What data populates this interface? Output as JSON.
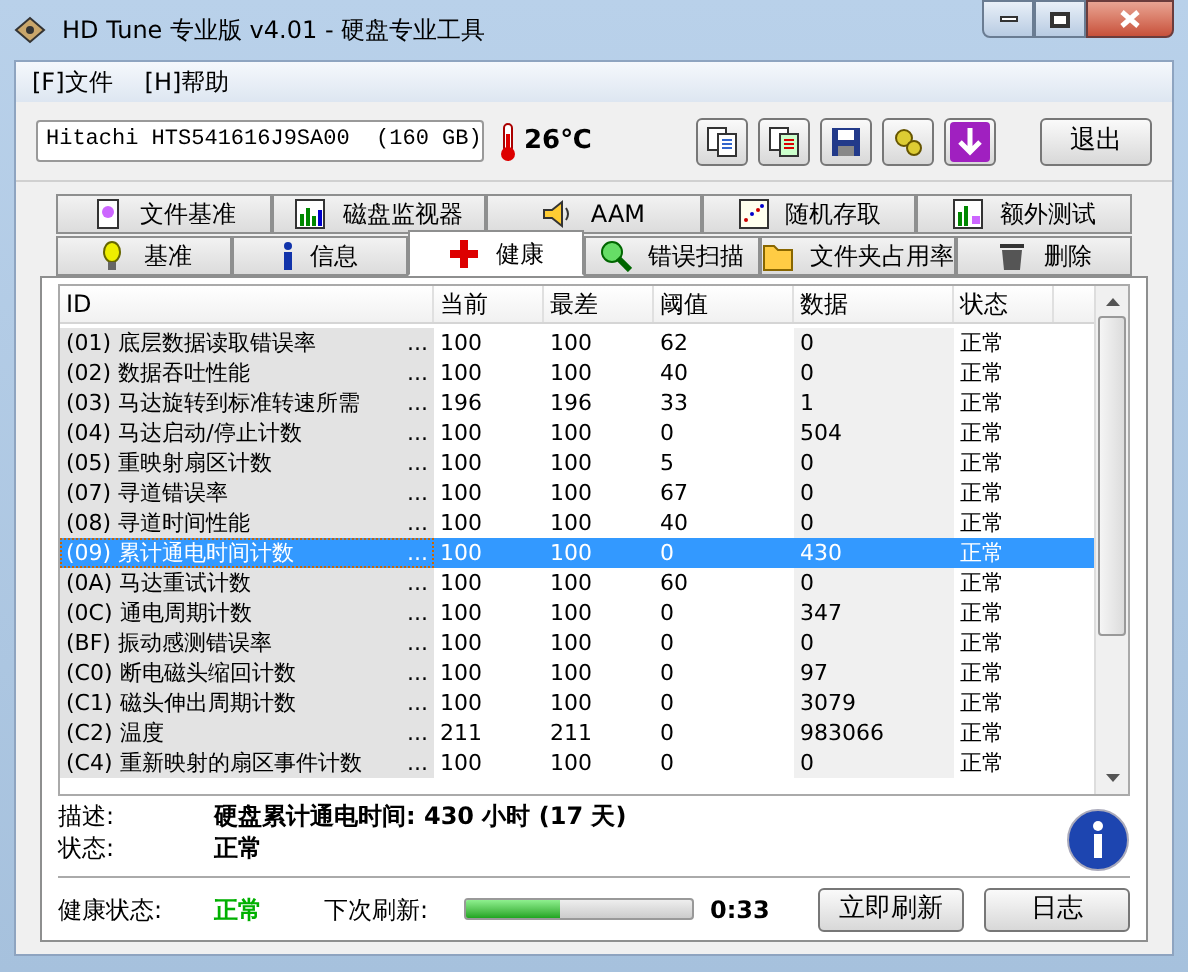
{
  "window": {
    "title": "HD Tune 专业版 v4.01 - 硬盘专业工具"
  },
  "menu": [
    "[F]文件",
    "[H]帮助"
  ],
  "drive": {
    "value": "Hitachi HTS541616J9SA00  (160 GB)"
  },
  "temperature": "26℃",
  "exit_button": "退出",
  "tabs_row_1": [
    {
      "label": "文件基准",
      "selected": false
    },
    {
      "label": "磁盘监视器",
      "selected": false
    },
    {
      "label": "AAM",
      "selected": false
    },
    {
      "label": "随机存取",
      "selected": false
    },
    {
      "label": "额外测试",
      "selected": false
    }
  ],
  "tabs_row_2": [
    {
      "label": "基准",
      "selected": false
    },
    {
      "label": "信息",
      "selected": false
    },
    {
      "label": "健康",
      "selected": true
    },
    {
      "label": "错误扫描",
      "selected": false
    },
    {
      "label": "文件夹占用率",
      "selected": false
    },
    {
      "label": "删除",
      "selected": false
    }
  ],
  "table": {
    "columns": [
      "ID",
      "当前",
      "最差",
      "阈值",
      "数据",
      "状态"
    ],
    "rows": [
      {
        "id": "(01) 底层数据读取错误率",
        "more": "...",
        "current": "100",
        "worst": "100",
        "threshold": "62",
        "data": "0",
        "status": "正常",
        "selected": false
      },
      {
        "id": "(02) 数据吞吐性能",
        "more": "...",
        "current": "100",
        "worst": "100",
        "threshold": "40",
        "data": "0",
        "status": "正常",
        "selected": false
      },
      {
        "id": "(03) 马达旋转到标准转速所需",
        "more": "...",
        "current": "196",
        "worst": "196",
        "threshold": "33",
        "data": "1",
        "status": "正常",
        "selected": false
      },
      {
        "id": "(04) 马达启动/停止计数",
        "more": "...",
        "current": "100",
        "worst": "100",
        "threshold": "0",
        "data": "504",
        "status": "正常",
        "selected": false
      },
      {
        "id": "(05) 重映射扇区计数",
        "more": "...",
        "current": "100",
        "worst": "100",
        "threshold": "5",
        "data": "0",
        "status": "正常",
        "selected": false
      },
      {
        "id": "(07) 寻道错误率",
        "more": "...",
        "current": "100",
        "worst": "100",
        "threshold": "67",
        "data": "0",
        "status": "正常",
        "selected": false
      },
      {
        "id": "(08) 寻道时间性能",
        "more": "...",
        "current": "100",
        "worst": "100",
        "threshold": "40",
        "data": "0",
        "status": "正常",
        "selected": false
      },
      {
        "id": "(09) 累计通电时间计数",
        "more": "...",
        "current": "100",
        "worst": "100",
        "threshold": "0",
        "data": "430",
        "status": "正常",
        "selected": true
      },
      {
        "id": "(0A) 马达重试计数",
        "more": "...",
        "current": "100",
        "worst": "100",
        "threshold": "60",
        "data": "0",
        "status": "正常",
        "selected": false
      },
      {
        "id": "(0C) 通电周期计数",
        "more": "...",
        "current": "100",
        "worst": "100",
        "threshold": "0",
        "data": "347",
        "status": "正常",
        "selected": false
      },
      {
        "id": "(BF) 振动感测错误率",
        "more": "...",
        "current": "100",
        "worst": "100",
        "threshold": "0",
        "data": "0",
        "status": "正常",
        "selected": false
      },
      {
        "id": "(C0) 断电磁头缩回计数",
        "more": "...",
        "current": "100",
        "worst": "100",
        "threshold": "0",
        "data": "97",
        "status": "正常",
        "selected": false
      },
      {
        "id": "(C1) 磁头伸出周期计数",
        "more": "...",
        "current": "100",
        "worst": "100",
        "threshold": "0",
        "data": "3079",
        "status": "正常",
        "selected": false
      },
      {
        "id": "(C2) 温度",
        "more": "...",
        "current": "211",
        "worst": "211",
        "threshold": "0",
        "data": "983066",
        "status": "正常",
        "selected": false
      },
      {
        "id": "(C4) 重新映射的扇区事件计数",
        "more": "...",
        "current": "100",
        "worst": "100",
        "threshold": "0",
        "data": "0",
        "status": "正常",
        "selected": false
      }
    ]
  },
  "description": {
    "label": "描述:",
    "value": "硬盘累计通电时间: 430 小时 (17 天)"
  },
  "status": {
    "label": "状态:",
    "value": "正常"
  },
  "health": {
    "label": "健康状态:",
    "value": "正常"
  },
  "refresh": {
    "label": "下次刷新:",
    "level": 0.42,
    "time": "0:33"
  },
  "buttons": [
    "立即刷新",
    "日志"
  ]
}
